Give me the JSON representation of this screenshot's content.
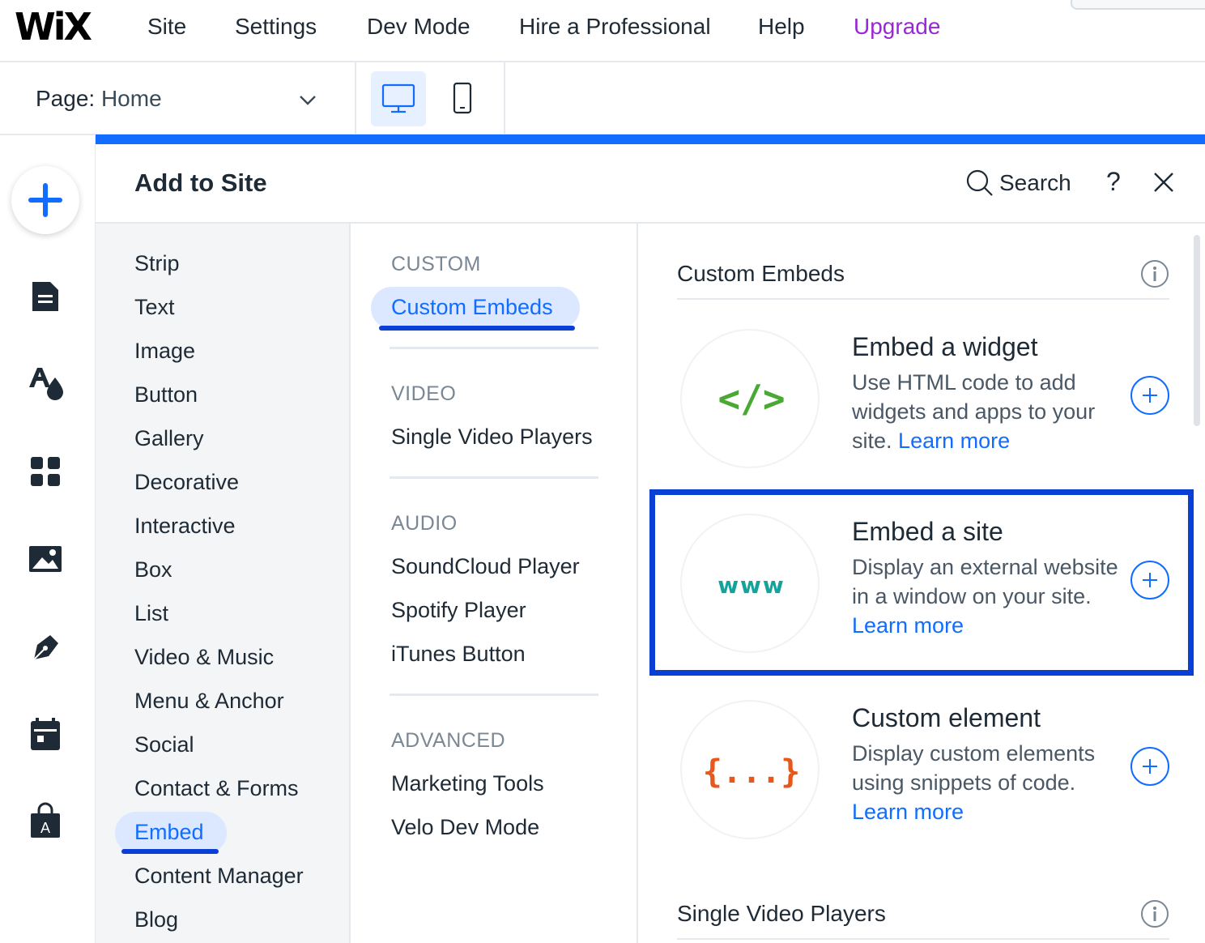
{
  "topbar": {
    "logo": "WiX",
    "nav": [
      "Site",
      "Settings",
      "Dev Mode",
      "Hire a Professional",
      "Help",
      "Upgrade"
    ]
  },
  "pagebar": {
    "page_label": "Page:",
    "page_value": "Home"
  },
  "panel": {
    "title": "Add to Site",
    "search_label": "Search",
    "help_label": "?"
  },
  "categories": [
    "Strip",
    "Text",
    "Image",
    "Button",
    "Gallery",
    "Decorative",
    "Interactive",
    "Box",
    "List",
    "Video & Music",
    "Menu & Anchor",
    "Social",
    "Contact & Forms",
    "Embed",
    "Content Manager",
    "Blog"
  ],
  "subcategories": {
    "custom": {
      "heading": "CUSTOM",
      "items": [
        "Custom Embeds"
      ]
    },
    "video": {
      "heading": "VIDEO",
      "items": [
        "Single Video Players"
      ]
    },
    "audio": {
      "heading": "AUDIO",
      "items": [
        "SoundCloud Player",
        "Spotify Player",
        "iTunes Button"
      ]
    },
    "advanced": {
      "heading": "ADVANCED",
      "items": [
        "Marketing Tools",
        "Velo Dev Mode"
      ]
    }
  },
  "content": {
    "section1_title": "Custom Embeds",
    "section2_title": "Single Video Players",
    "cards": [
      {
        "title": "Embed a widget",
        "desc": "Use HTML code to add widgets and apps to your site.",
        "link": "Learn more",
        "icon_text": "</>"
      },
      {
        "title": "Embed a site",
        "desc": "Display an external website in a window on your site.",
        "link": "Learn more",
        "icon_text": "www"
      },
      {
        "title": "Custom element",
        "desc": "Display custom elements using snippets of code.",
        "link": "Learn more",
        "icon_text": "{...}"
      }
    ]
  },
  "colors": {
    "accent": "#116dff",
    "upgrade": "#9a27d5",
    "highlight": "#0a3fd6"
  },
  "icons": [
    "plus-icon",
    "pages-icon",
    "theme-icon",
    "apps-icon",
    "media-icon",
    "pen-icon",
    "calendar-icon",
    "store-icon"
  ]
}
